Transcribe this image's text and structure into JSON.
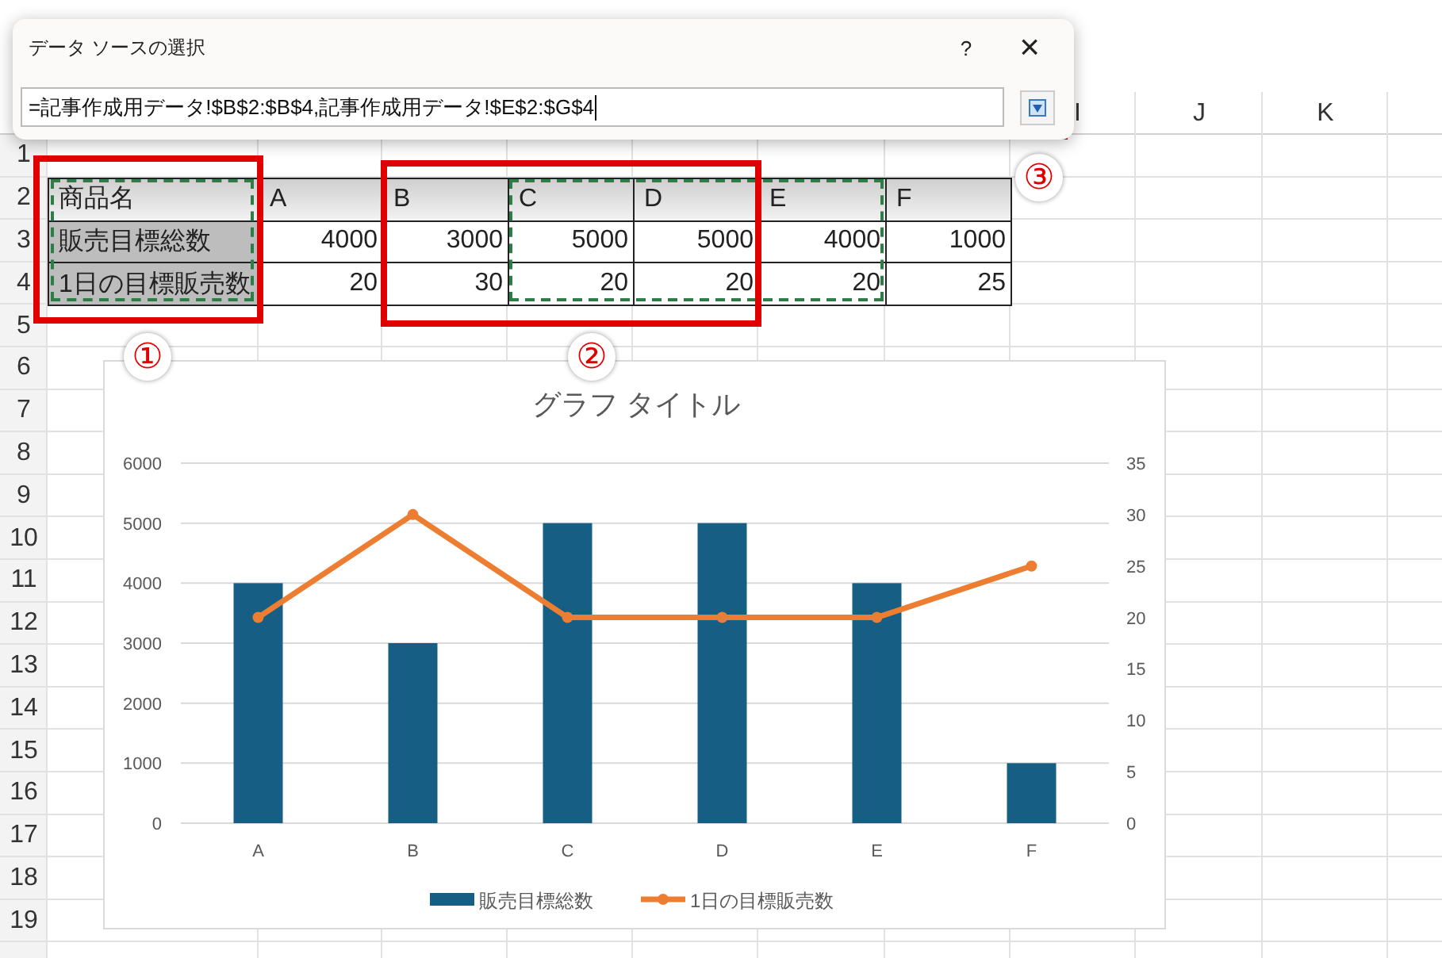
{
  "dialog": {
    "title": "データ ソースの選択",
    "help": "?",
    "close": "×",
    "range": "=記事作成用データ!$B$2:$B$4,記事作成用データ!$E$2:$G$4"
  },
  "column_headers": [
    "I",
    "J",
    "K"
  ],
  "row_headers": [
    "1",
    "2",
    "3",
    "4",
    "5",
    "6",
    "7",
    "8",
    "9",
    "10",
    "11",
    "12",
    "13",
    "14",
    "15",
    "16",
    "17",
    "18",
    "19"
  ],
  "table": {
    "header": [
      "商品名",
      "A",
      "B",
      "C",
      "D",
      "E",
      "F"
    ],
    "rows": [
      {
        "label": "販売目標総数",
        "values": [
          "4000",
          "3000",
          "5000",
          "5000",
          "4000",
          "1000"
        ]
      },
      {
        "label": "1日の目標販売数",
        "values": [
          "20",
          "30",
          "20",
          "20",
          "20",
          "25"
        ]
      }
    ]
  },
  "callouts": [
    "①",
    "②",
    "③"
  ],
  "chart": {
    "chart_data": {
      "type": "bar",
      "title": "グラフ タイトル",
      "categories": [
        "A",
        "B",
        "C",
        "D",
        "E",
        "F"
      ],
      "grid": true,
      "legend": "bottom",
      "series": [
        {
          "name": "販売目標総数",
          "type": "bar",
          "color": "#165e83",
          "values": [
            4000,
            3000,
            5000,
            5000,
            4000,
            1000
          ]
        },
        {
          "name": "1日の目標販売数",
          "type": "line",
          "axis": "y2",
          "marker": "circle",
          "color": "#ed7d31",
          "values": [
            20,
            30,
            20,
            20,
            20,
            25
          ]
        }
      ],
      "ylim": [
        0,
        6000
      ],
      "yticks": [
        0,
        1000,
        2000,
        3000,
        4000,
        5000,
        6000
      ],
      "y2lim": [
        0,
        35
      ],
      "y2ticks": [
        0,
        5,
        10,
        15,
        20,
        25,
        30,
        35
      ]
    }
  }
}
